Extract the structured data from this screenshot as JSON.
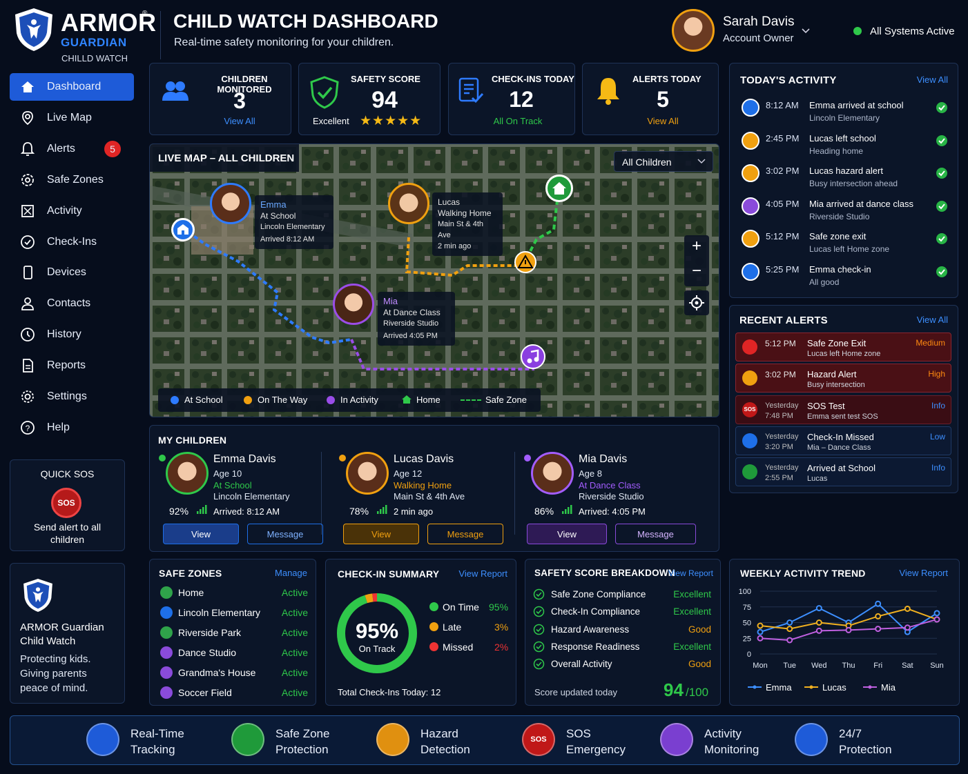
{
  "brand": {
    "name": "ARMOR",
    "sub": "GUARDIAN",
    "sub2": "CHILLD WATCH",
    "trademark": "®"
  },
  "header": {
    "title": "CHILD WATCH DASHBOARD",
    "subtitle": "Real-time safety monitoring for your children."
  },
  "user": {
    "name": "Sarah Davis",
    "role": "Account Owner"
  },
  "system_status": "All Systems Active",
  "nav": [
    {
      "label": "Dashboard",
      "icon": "home-icon"
    },
    {
      "label": "Live Map",
      "icon": "map-pin-icon"
    },
    {
      "label": "Alerts",
      "icon": "bell-icon",
      "badge": "5"
    },
    {
      "label": "Safe Zones",
      "icon": "gear-zone-icon"
    },
    {
      "label": "Activity",
      "icon": "activity-icon"
    },
    {
      "label": "Check-Ins",
      "icon": "check-circle-icon"
    },
    {
      "label": "Devices",
      "icon": "phone-icon"
    },
    {
      "label": "Contacts",
      "icon": "contact-icon"
    },
    {
      "label": "History",
      "icon": "clock-icon"
    },
    {
      "label": "Reports",
      "icon": "document-icon"
    },
    {
      "label": "Settings",
      "icon": "settings-icon"
    },
    {
      "label": "Help",
      "icon": "help-icon"
    }
  ],
  "quick_sos": {
    "title": "QUICK SOS",
    "button": "SOS",
    "text": "Send alert to all children"
  },
  "promo": {
    "line1": "ARMOR Guardian",
    "line2": "Child Watch",
    "tagline": "Protecting kids. Giving parents peace of mind."
  },
  "stats": [
    {
      "label": "CHILDREN MONITORED",
      "value": "3",
      "footer": "View All"
    },
    {
      "label": "SAFETY SCORE",
      "value": "94",
      "footer": "Excellent",
      "stars": 5
    },
    {
      "label": "CHECK-INS TODAY",
      "value": "12",
      "footer": "All On Track"
    },
    {
      "label": "ALERTS TODAY",
      "value": "5",
      "footer": "View All"
    }
  ],
  "map": {
    "title": "LIVE MAP – ALL CHILDREN",
    "filter": "All Children",
    "pins": [
      {
        "name": "Emma",
        "line1": "At School",
        "line2": "Lincoln Elementary",
        "line3": "Arrived 8:12 AM"
      },
      {
        "name": "Lucas",
        "line1": "Walking Home",
        "line2": "Main St & 4th Ave",
        "line3": "2 min ago"
      },
      {
        "name": "Mia",
        "line1": "At Dance Class",
        "line2": "Riverside Studio",
        "line3": "Arrived 4:05 PM"
      }
    ],
    "legend": [
      "At School",
      "On The Way",
      "In Activity",
      "Home",
      "Safe Zone"
    ],
    "controls": {
      "zoom_in": "+",
      "zoom_out": "−"
    }
  },
  "activity": {
    "title": "TODAY'S ACTIVITY",
    "link": "View All",
    "items": [
      {
        "time": "8:12 AM",
        "title": "Emma arrived at school",
        "sub": "Lincoln Elementary",
        "color": "#1e6fe8"
      },
      {
        "time": "2:45 PM",
        "title": "Lucas left school",
        "sub": "Heading home",
        "color": "#f0a010"
      },
      {
        "time": "3:02 PM",
        "title": "Lucas hazard alert",
        "sub": "Busy intersection ahead",
        "color": "#f0a010"
      },
      {
        "time": "4:05 PM",
        "title": "Mia arrived at dance class",
        "sub": "Riverside Studio",
        "color": "#8a4bdb"
      },
      {
        "time": "5:12 PM",
        "title": "Safe zone exit",
        "sub": "Lucas left Home zone",
        "color": "#f0a010"
      },
      {
        "time": "5:25 PM",
        "title": "Emma check-in",
        "sub": "All good",
        "color": "#1e6fe8"
      }
    ]
  },
  "alerts": {
    "title": "RECENT ALERTS",
    "link": "View All",
    "items": [
      {
        "time": "5:12 PM",
        "title": "Safe Zone Exit",
        "sub": "Lucas left Home zone",
        "level": "Medium"
      },
      {
        "time": "3:02 PM",
        "title": "Hazard Alert",
        "sub": "Busy intersection",
        "level": "High"
      },
      {
        "time_a": "Yesterday",
        "time_b": "7:48 PM",
        "title": "SOS Test",
        "sub": "Emma sent test SOS",
        "level": "Info",
        "icon": "SOS"
      },
      {
        "time_a": "Yesterday",
        "time_b": "3:20 PM",
        "title": "Check-In Missed",
        "sub": "Mia – Dance Class",
        "level": "Low"
      },
      {
        "time_a": "Yesterday",
        "time_b": "2:55 PM",
        "title": "Arrived at School",
        "sub": "Lucas",
        "level": "Info"
      }
    ]
  },
  "children": {
    "title": "MY CHILDREN",
    "items": [
      {
        "name": "Emma Davis",
        "age": "Age 10",
        "status": "At School",
        "place": "Lincoln Elementary",
        "battery": "92%",
        "time": "Arrived: 8:12 AM",
        "view": "View",
        "message": "Message"
      },
      {
        "name": "Lucas Davis",
        "age": "Age 12",
        "status": "Walking Home",
        "place": "Main St & 4th Ave",
        "battery": "78%",
        "time": "2 min ago",
        "view": "View",
        "message": "Message"
      },
      {
        "name": "Mia Davis",
        "age": "Age 8",
        "status": "At Dance Class",
        "place": "Riverside Studio",
        "battery": "86%",
        "time": "Arrived: 4:05 PM",
        "view": "View",
        "message": "Message"
      }
    ]
  },
  "safe_zones": {
    "title": "SAFE ZONES",
    "link": "Manage",
    "items": [
      {
        "name": "Home",
        "status": "Active",
        "color": "#2fa34a"
      },
      {
        "name": "Lincoln Elementary",
        "status": "Active",
        "color": "#1e6fe8"
      },
      {
        "name": "Riverside Park",
        "status": "Active",
        "color": "#2fa34a"
      },
      {
        "name": "Dance Studio",
        "status": "Active",
        "color": "#8a4bdb"
      },
      {
        "name": "Grandma's House",
        "status": "Active",
        "color": "#8a4bdb"
      },
      {
        "name": "Soccer Field",
        "status": "Active",
        "color": "#8a4bdb"
      }
    ]
  },
  "checkin": {
    "title": "CHECK-IN SUMMARY",
    "link": "View Report",
    "percent": "95%",
    "center_label": "On Track",
    "total": "Total Check-Ins Today: 12",
    "rows": [
      {
        "label": "On Time",
        "value": "95%",
        "frac": 0.95
      },
      {
        "label": "Late",
        "value": "3%",
        "frac": 0.03
      },
      {
        "label": "Missed",
        "value": "2%",
        "frac": 0.02
      }
    ]
  },
  "score": {
    "title": "SAFETY SCORE BREAKDOWN",
    "link": "View Report",
    "updated": "Score updated today",
    "value": "94",
    "max": "/100",
    "rows": [
      {
        "name": "Safe Zone Compliance",
        "value": "Excellent"
      },
      {
        "name": "Check-In Compliance",
        "value": "Excellent"
      },
      {
        "name": "Hazard Awareness",
        "value": "Good"
      },
      {
        "name": "Response Readiness",
        "value": "Excellent"
      },
      {
        "name": "Overall Activity",
        "value": "Good"
      }
    ]
  },
  "weekly": {
    "title": "WEEKLY ACTIVITY TREND",
    "link": "View Report"
  },
  "chart_data": {
    "type": "line",
    "categories": [
      "Mon",
      "Tue",
      "Wed",
      "Thu",
      "Fri",
      "Sat",
      "Sun"
    ],
    "ylim": [
      0,
      100
    ],
    "yticks": [
      0,
      25,
      50,
      75,
      100
    ],
    "series": [
      {
        "name": "Emma",
        "color": "#3d8fff",
        "values": [
          35,
          50,
          73,
          50,
          80,
          35,
          65
        ]
      },
      {
        "name": "Lucas",
        "color": "#f0b020",
        "values": [
          45,
          40,
          50,
          45,
          60,
          72,
          55
        ]
      },
      {
        "name": "Mia",
        "color": "#c060e0",
        "values": [
          25,
          22,
          37,
          38,
          40,
          42,
          55
        ]
      }
    ]
  },
  "features": [
    {
      "line1": "Real-Time",
      "line2": "Tracking"
    },
    {
      "line1": "Safe Zone",
      "line2": "Protection"
    },
    {
      "line1": "Hazard",
      "line2": "Detection"
    },
    {
      "line1": "SOS",
      "line2": "Emergency",
      "icon": "SOS"
    },
    {
      "line1": "Activity",
      "line2": "Monitoring"
    },
    {
      "line1": "24/7",
      "line2": "Protection"
    }
  ]
}
